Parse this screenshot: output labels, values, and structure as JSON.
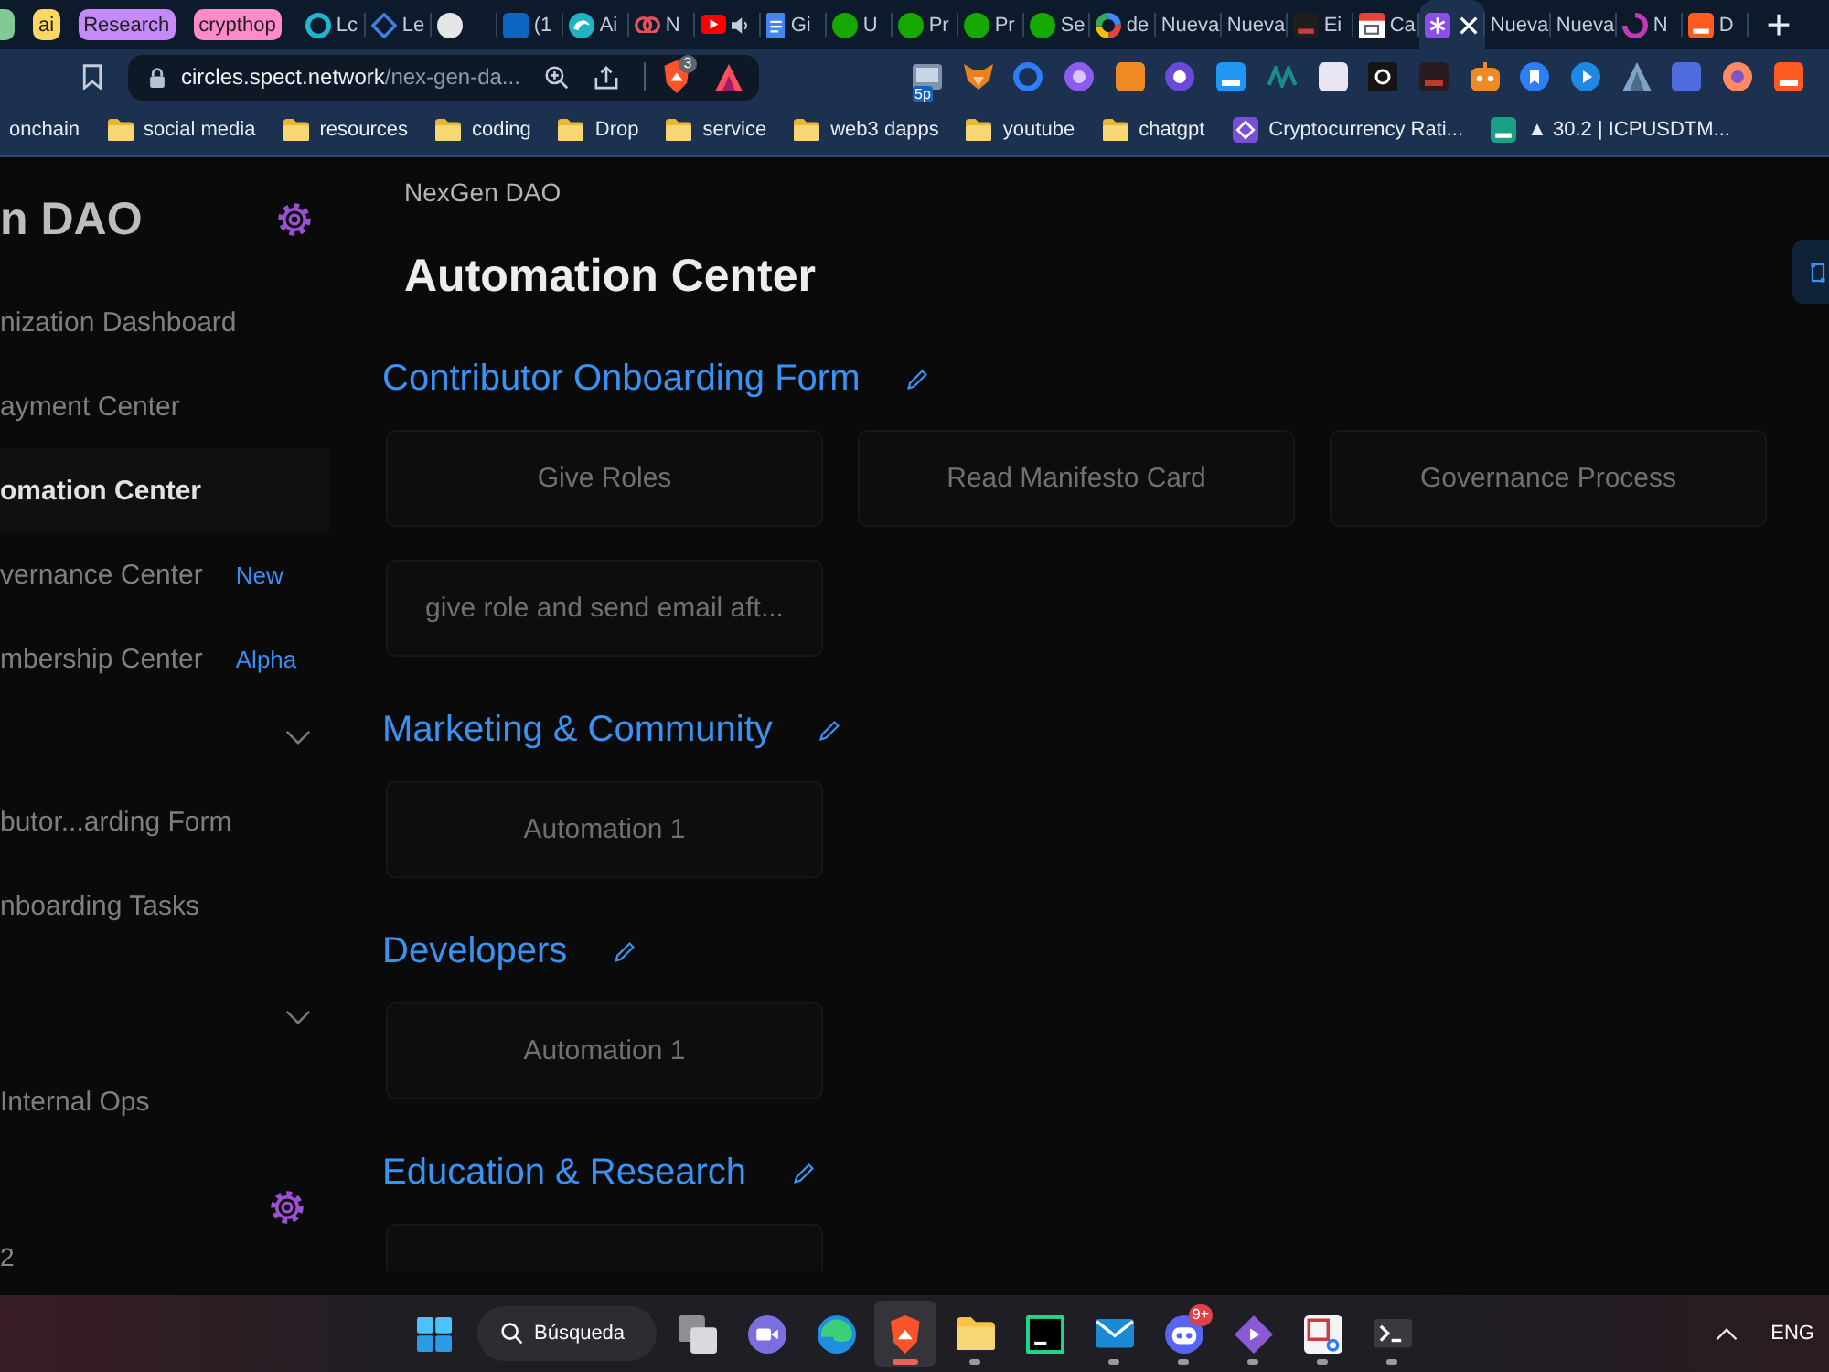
{
  "browser": {
    "tab_groups": [
      {
        "color": "#81c995"
      },
      {
        "label": "ai",
        "color": "#fdd663"
      },
      {
        "label": "Research",
        "color": "#c58af9"
      },
      {
        "label": "crypthop",
        "color": "#ff8bcb"
      }
    ],
    "tabs": [
      {
        "title": "Lc",
        "selected": false,
        "audio": false
      },
      {
        "title": "Le",
        "selected": false,
        "audio": false
      },
      {
        "selected": false,
        "audio": false
      },
      {
        "title": "(1",
        "selected": false,
        "audio": false
      },
      {
        "title": "Ai",
        "selected": false,
        "audio": false
      },
      {
        "title": "N",
        "selected": false,
        "audio": false
      },
      {
        "selected": false,
        "audio": true
      },
      {
        "title": "Gi",
        "selected": false,
        "audio": false
      },
      {
        "title": "U",
        "selected": false,
        "audio": false
      },
      {
        "title": "Pr",
        "selected": false,
        "audio": false
      },
      {
        "title": "Pr",
        "selected": false,
        "audio": false
      },
      {
        "title": "Se",
        "selected": false,
        "audio": false
      },
      {
        "title": "de",
        "selected": false,
        "audio": false
      },
      {
        "title": "Nueva",
        "selected": false,
        "audio": false
      },
      {
        "title": "Nueva",
        "selected": false,
        "audio": false
      },
      {
        "title": "Ei",
        "selected": false,
        "audio": false
      },
      {
        "title": "Ca",
        "selected": false,
        "audio": false
      },
      {
        "selected": true,
        "audio": false
      },
      {
        "title": "Nueva",
        "selected": false,
        "audio": false
      },
      {
        "title": "Nueva",
        "selected": false,
        "audio": false
      },
      {
        "title": "N",
        "selected": false,
        "audio": false
      },
      {
        "title": "D",
        "selected": false,
        "audio": false
      }
    ],
    "toolbar": {
      "url_host": "circles.spect.network",
      "url_path": "/nex-gen-da...",
      "shield_badge": "3",
      "extension_badge": "5p"
    },
    "bookmarks": [
      {
        "kind": "site",
        "label": "onchain"
      },
      {
        "kind": "folder",
        "label": "social media"
      },
      {
        "kind": "folder",
        "label": "resources"
      },
      {
        "kind": "folder",
        "label": "coding"
      },
      {
        "kind": "folder",
        "label": "Drop"
      },
      {
        "kind": "folder",
        "label": "service"
      },
      {
        "kind": "folder",
        "label": "web3 dapps"
      },
      {
        "kind": "folder",
        "label": "youtube"
      },
      {
        "kind": "folder",
        "label": "chatgpt"
      },
      {
        "kind": "site",
        "label": "Cryptocurrency Rati..."
      },
      {
        "kind": "site",
        "label": "▲ 30.2 | ICPUSDTM..."
      }
    ]
  },
  "sidebar": {
    "title": "n DAO",
    "nav": [
      {
        "label": "nization Dashboard",
        "selected": false
      },
      {
        "label": "ayment Center",
        "selected": false
      },
      {
        "label": "omation Center",
        "selected": true
      },
      {
        "label": "vernance Center",
        "selected": false,
        "badge": "New"
      },
      {
        "label": "mbership Center",
        "selected": false,
        "badge": "Alpha"
      }
    ],
    "groups": [
      {
        "expanded": true,
        "items": [
          {
            "label": "butor...arding Form",
            "selected": false
          },
          {
            "label": "nboarding Tasks",
            "selected": false
          }
        ]
      },
      {
        "expanded": true,
        "items": [
          {
            "label": "Internal Ops",
            "selected": false
          }
        ]
      }
    ],
    "footer": "2"
  },
  "main": {
    "breadcrumb": "NexGen DAO",
    "title": "Automation Center",
    "sections": [
      {
        "title": "Contributor Onboarding Form",
        "automations": [
          {
            "kind": "card",
            "label": "Give Roles"
          },
          {
            "kind": "card",
            "label": "Read Manifesto Card"
          },
          {
            "kind": "card",
            "label": "Governance Process"
          },
          {
            "kind": "card",
            "label": "give role and send email aft..."
          }
        ]
      },
      {
        "title": "Marketing & Community",
        "automations": [
          {
            "kind": "card",
            "label": "Automation 1"
          }
        ]
      },
      {
        "title": "Developers",
        "automations": [
          {
            "kind": "card",
            "label": "Automation 1"
          }
        ]
      },
      {
        "title": "Education & Research",
        "automations": [
          {
            "kind": "stub"
          }
        ]
      }
    ]
  },
  "taskbar": {
    "search_label": "Búsqueda",
    "apps": [
      {
        "running": false,
        "selected": false
      },
      {
        "running": false,
        "selected": false
      },
      {
        "running": false,
        "selected": false
      },
      {
        "running": true,
        "selected": true
      },
      {
        "running": true,
        "selected": false
      },
      {
        "running": false,
        "selected": false
      },
      {
        "running": true,
        "selected": false
      },
      {
        "running": true,
        "selected": false,
        "badge": "9+"
      },
      {
        "running": true,
        "selected": false
      },
      {
        "running": true,
        "selected": false
      },
      {
        "running": true,
        "selected": false
      }
    ],
    "language": "ENG"
  }
}
